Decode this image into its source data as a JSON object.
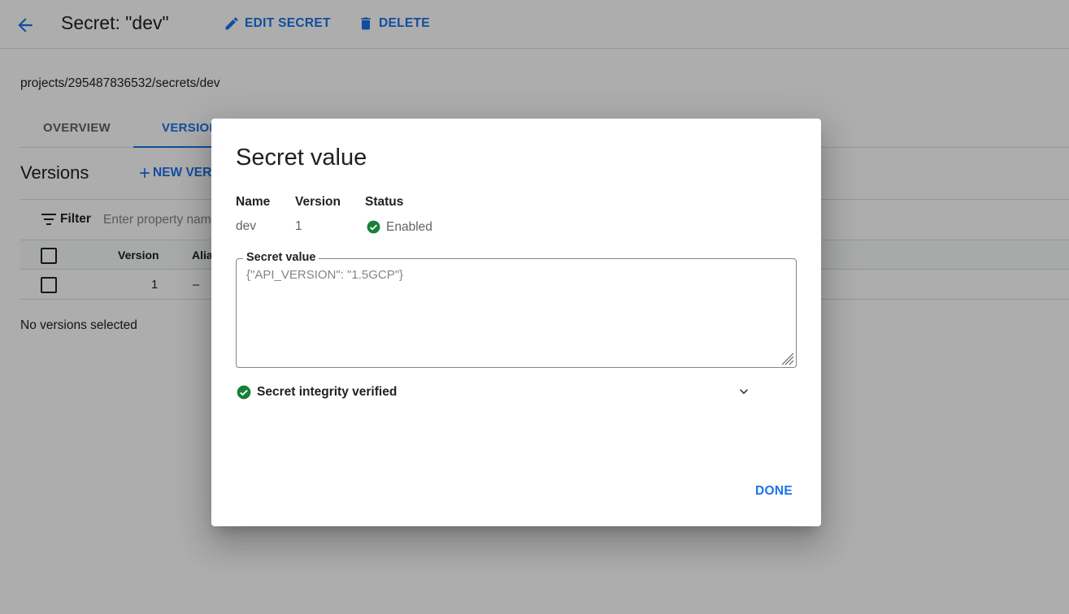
{
  "header": {
    "title": "Secret: \"dev\"",
    "edit_label": "EDIT SECRET",
    "delete_label": "DELETE"
  },
  "resource_path": "projects/295487836532/secrets/dev",
  "tabs": [
    {
      "label": "OVERVIEW",
      "active": false
    },
    {
      "label": "VERSIONS",
      "active": true
    }
  ],
  "versions_section": {
    "title": "Versions",
    "new_version_label": "NEW VERSION"
  },
  "filter": {
    "label": "Filter",
    "placeholder": "Enter property name or value"
  },
  "table": {
    "headers": {
      "version": "Version",
      "alias": "Aliases"
    },
    "rows": [
      {
        "version": "1",
        "alias": "–"
      }
    ]
  },
  "selection_status": "No versions selected",
  "dialog": {
    "title": "Secret value",
    "meta": {
      "name_label": "Name",
      "name_value": "dev",
      "version_label": "Version",
      "version_value": "1",
      "status_label": "Status",
      "status_value": "Enabled"
    },
    "secret_field": {
      "legend": "Secret value",
      "value": "{\"API_VERSION\": \"1.5GCP\"}"
    },
    "integrity_text": "Secret integrity verified",
    "done_label": "DONE"
  },
  "colors": {
    "accent": "#1a73e8",
    "success": "#188038",
    "overlay": "rgba(0,0,0,0.32)"
  },
  "icons": [
    "back-arrow-icon",
    "pencil-icon",
    "trash-icon",
    "plus-icon",
    "filter-icon",
    "check-circle-icon",
    "chevron-down-icon",
    "resize-handle-icon"
  ]
}
